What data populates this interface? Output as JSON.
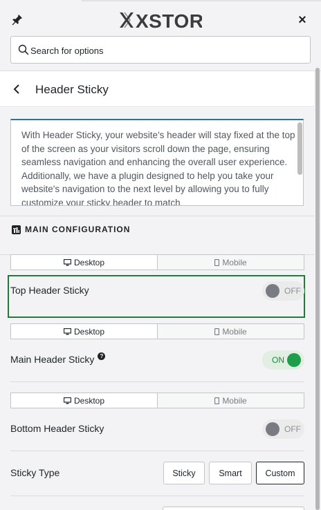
{
  "header": {
    "logo_text": "XSTORE",
    "close_label": "×",
    "search_placeholder": "Search for options"
  },
  "panel": {
    "title": "Header Sticky",
    "description": "With Header Sticky, your website's header will stay fixed at the top of the screen as your visitors scroll down the page, ensuring seamless navigation and enhancing the overall user experience. Additionally, we have a plugin designed to help you take your website's navigation to the next level by allowing you to fully customize your sticky header to match"
  },
  "section": {
    "title": "MAIN CONFIGURATION"
  },
  "device_tabs": {
    "desktop": "Desktop",
    "mobile": "Mobile"
  },
  "controls": {
    "top_header": {
      "label": "Top Header Sticky",
      "state": "OFF"
    },
    "main_header": {
      "label": "Main Header Sticky",
      "state": "ON",
      "help": "?"
    },
    "bottom_header": {
      "label": "Bottom Header Sticky",
      "state": "OFF"
    },
    "sticky_type": {
      "label": "Sticky Type",
      "options": [
        "Sticky",
        "Smart",
        "Custom"
      ],
      "selected": "Custom"
    }
  },
  "colors": {
    "toggle_on": "#1f9d49",
    "toggle_off": "#787c82",
    "highlight": "#1e7b38",
    "accent": "#2271b1"
  }
}
